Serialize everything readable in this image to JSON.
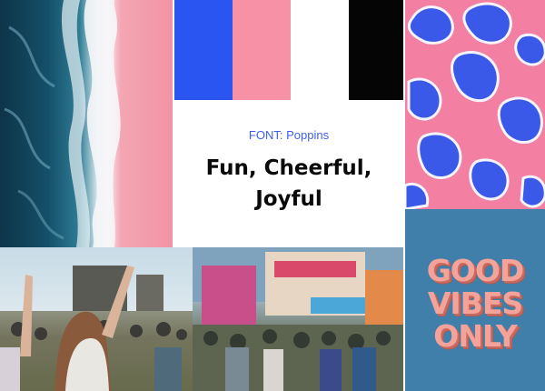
{
  "font_label": "FONT: Poppins",
  "headline": [
    "Fun, Cheerful,",
    "Joyful"
  ],
  "swatches": {
    "blue": "#2a55f0",
    "pink": "#f691a6",
    "white": "#ffffff",
    "black": "#050505"
  },
  "vibes": [
    "GOOD",
    "VIBES",
    "ONLY"
  ],
  "colors": {
    "accent_text": "#3d5df2",
    "pattern_bg": "#f37fa2",
    "pattern_blob": "#3a59e8",
    "vibes_bg": "#3f7fa9",
    "vibes_text": "#f3a39a"
  }
}
